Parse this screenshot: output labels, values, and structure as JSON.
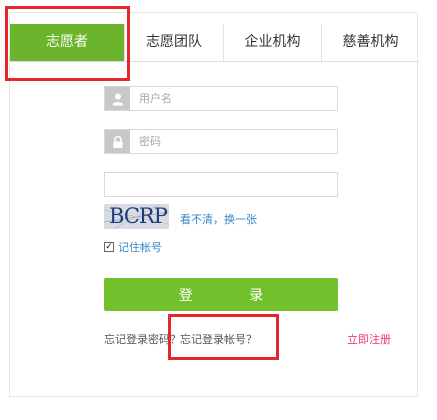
{
  "tabs": [
    {
      "label": "志愿者",
      "active": true
    },
    {
      "label": "志愿团队",
      "active": false
    },
    {
      "label": "企业机构",
      "active": false
    },
    {
      "label": "慈善机构",
      "active": false
    }
  ],
  "form": {
    "username_placeholder": "用户名",
    "password_placeholder": "密码",
    "captcha_value": "",
    "captcha_text": "BCRP",
    "refresh_label": "看不清，换一张",
    "remember_label": "记住帐号",
    "remember_checked": true,
    "login_label": "登 录"
  },
  "links": {
    "forgot_password": "忘记登录密码？",
    "forgot_account": "忘记登录帐号？",
    "register": "立即注册"
  },
  "colors": {
    "accent": "#6ab52c",
    "highlight": "#e8252a",
    "link": "#3b86c4",
    "register": "#e53b6a"
  },
  "icons": {
    "username": "user-icon",
    "password": "lock-icon",
    "remember": "checkbox-icon"
  }
}
